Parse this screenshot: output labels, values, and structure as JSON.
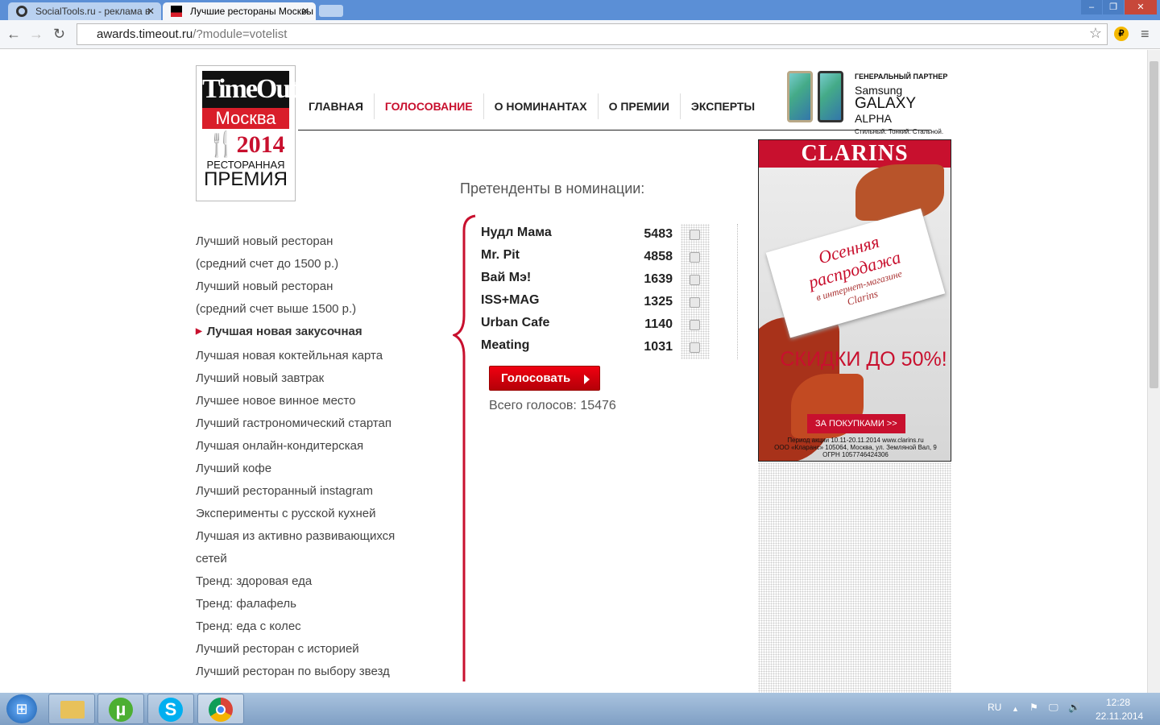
{
  "browser": {
    "tabs": [
      {
        "title": "SocialTools.ru - реклама в"
      },
      {
        "title": "Лучшие рестораны Москвы"
      }
    ],
    "url_host": "awards.timeout.ru",
    "url_path": "/?module=votelist"
  },
  "logo": {
    "line1": "TimeOut",
    "line2": "Москва",
    "year": "2014",
    "line3": "РЕСТОРАННАЯ",
    "line4": "ПРЕМИЯ"
  },
  "menu": [
    {
      "label": "ГЛАВНАЯ"
    },
    {
      "label": "ГОЛОСОВАНИЕ"
    },
    {
      "label": "О НОМИНАНТАХ"
    },
    {
      "label": "О ПРЕМИИ"
    },
    {
      "label": "ЭКСПЕРТЫ"
    }
  ],
  "partner": {
    "label": "ГЕНЕРАЛЬНЫЙ ПАРТНЕР",
    "brand": "Samsung",
    "model": "GALAXY",
    "model2": "ALPHA",
    "slogan": "Стильный. Тонкий. Стальной."
  },
  "categories": [
    "Лучший новый ресторан",
    "(средний счет до 1500 р.)",
    "Лучший новый ресторан",
    "(средний счет выше 1500 р.)",
    "Лучшая новая закусочная",
    "Лучшая новая коктейльная карта",
    "Лучший новый завтрак",
    "Лучшее новое винное место",
    "Лучший гастрономический стартап",
    "Лучшая онлайн-кондитерская",
    "Лучший кофе",
    "Лучший ресторанный instagram",
    "Эксперименты с русской кухней",
    "Лучшая из активно развивающихся",
    "сетей",
    "Тренд: здоровая еда",
    "Тренд: фалафель",
    "Тренд: еда с колес",
    "Лучший ресторан с историей",
    "Лучший ресторан по выбору звезд"
  ],
  "nominees_title": "Претенденты в номинации:",
  "nominees": [
    {
      "name": "Нудл Мама",
      "votes": "5483"
    },
    {
      "name": "Mr. Pit",
      "votes": "4858"
    },
    {
      "name": "Вай Мэ!",
      "votes": "1639"
    },
    {
      "name": "ISS+MAG",
      "votes": "1325"
    },
    {
      "name": "Urban Cafe",
      "votes": "1140"
    },
    {
      "name": "Meating",
      "votes": "1031"
    }
  ],
  "vote_label": "Голосовать",
  "total_label": "Всего голосов: 15476",
  "ad": {
    "brand": "CLARINS",
    "tag1": "Осенняя",
    "tag2": "распродажа",
    "tag3": "в интернет-магазине",
    "tag4": "Clarins",
    "sale": "СКИДКИ ДО 50%!",
    "button": "ЗА ПОКУПКАМИ >>",
    "fine1": "Период акции 10.11-20.11.2014 www.clarins.ru",
    "fine2": "ООО «Кларанс» 105064, Москва, ул. Земляной Вал, 9",
    "fine3": "ОГРН 1057746424306"
  },
  "taskbar": {
    "lang": "RU",
    "time": "12:28",
    "date": "22.11.2014"
  },
  "colors": {
    "accent": "#c8102e"
  }
}
